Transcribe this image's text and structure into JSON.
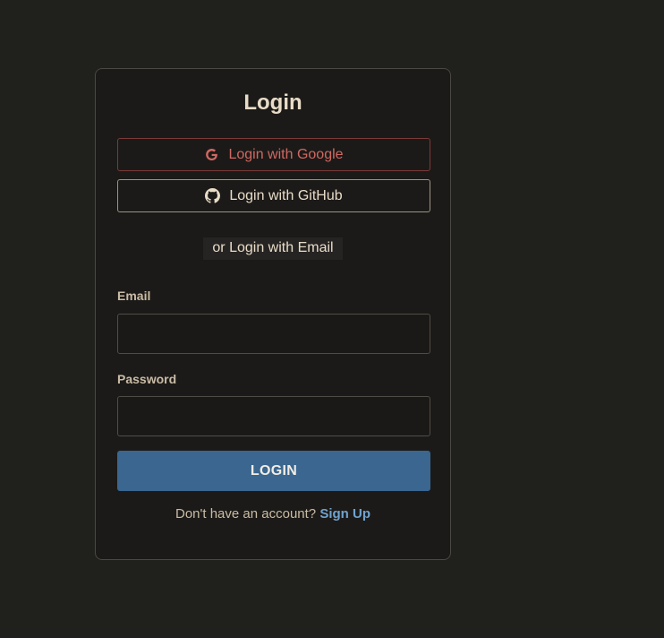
{
  "login": {
    "title": "Login",
    "google_label": "Login with Google",
    "github_label": "Login with GitHub",
    "divider_text": "or Login with Email",
    "email_label": "Email",
    "email_value": "",
    "password_label": "Password",
    "password_value": "",
    "submit_label": "LOGIN",
    "signup_prompt": "Don't have an account?",
    "signup_link": "Sign Up"
  },
  "icons": {
    "google": "google-icon",
    "github": "github-icon"
  },
  "colors": {
    "background": "#20201d",
    "card": "#1c1a18",
    "google_accent": "#d06862",
    "primary_button": "#3a6690",
    "link": "#6fa3cf"
  }
}
